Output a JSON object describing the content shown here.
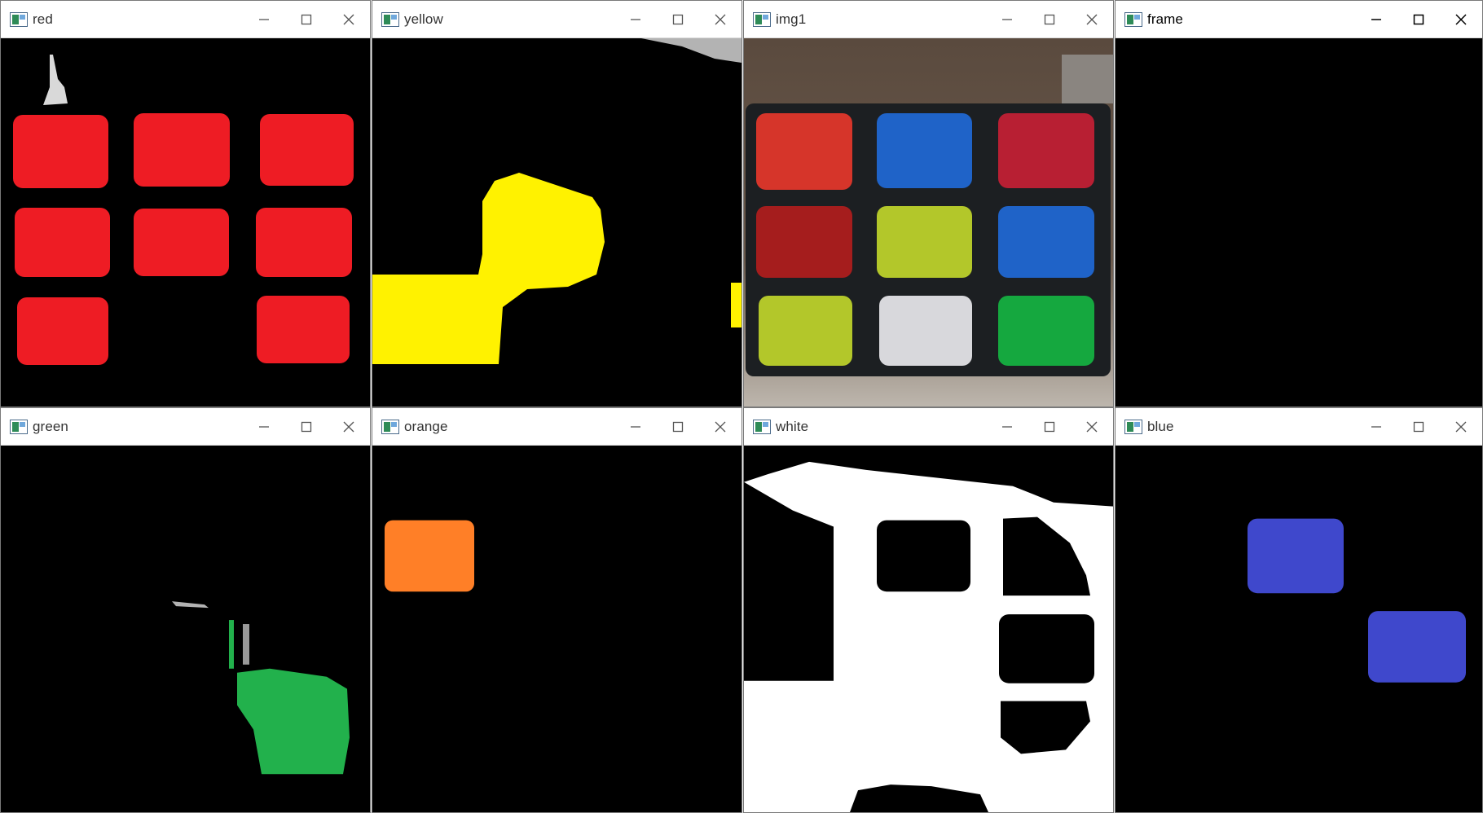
{
  "windows": [
    {
      "id": "red",
      "title": "red"
    },
    {
      "id": "yellow",
      "title": "yellow"
    },
    {
      "id": "img1",
      "title": "img1"
    },
    {
      "id": "frame",
      "title": "frame"
    },
    {
      "id": "green",
      "title": "green"
    },
    {
      "id": "orange",
      "title": "orange"
    },
    {
      "id": "white",
      "title": "white"
    },
    {
      "id": "blue",
      "title": "blue"
    }
  ],
  "controls": {
    "minimize_icon": "minimize-icon",
    "maximize_icon": "maximize-icon",
    "close_icon": "close-icon"
  },
  "colors": {
    "mask_red": "#ee1c24",
    "mask_yellow": "#fff200",
    "mask_green": "#22b14c",
    "mask_orange": "#ff7f27",
    "mask_blue": "#3f48cc",
    "mask_white": "#ffffff",
    "background": "#000000",
    "cube_red": "#d6352a",
    "cube_blue": "#1f63c8",
    "cube_crimson": "#b81f33",
    "cube_darkred": "#a51d1d",
    "cube_yellowgreen": "#b3c72a",
    "cube_white": "#d8d8dc",
    "cube_green": "#15a83f"
  }
}
